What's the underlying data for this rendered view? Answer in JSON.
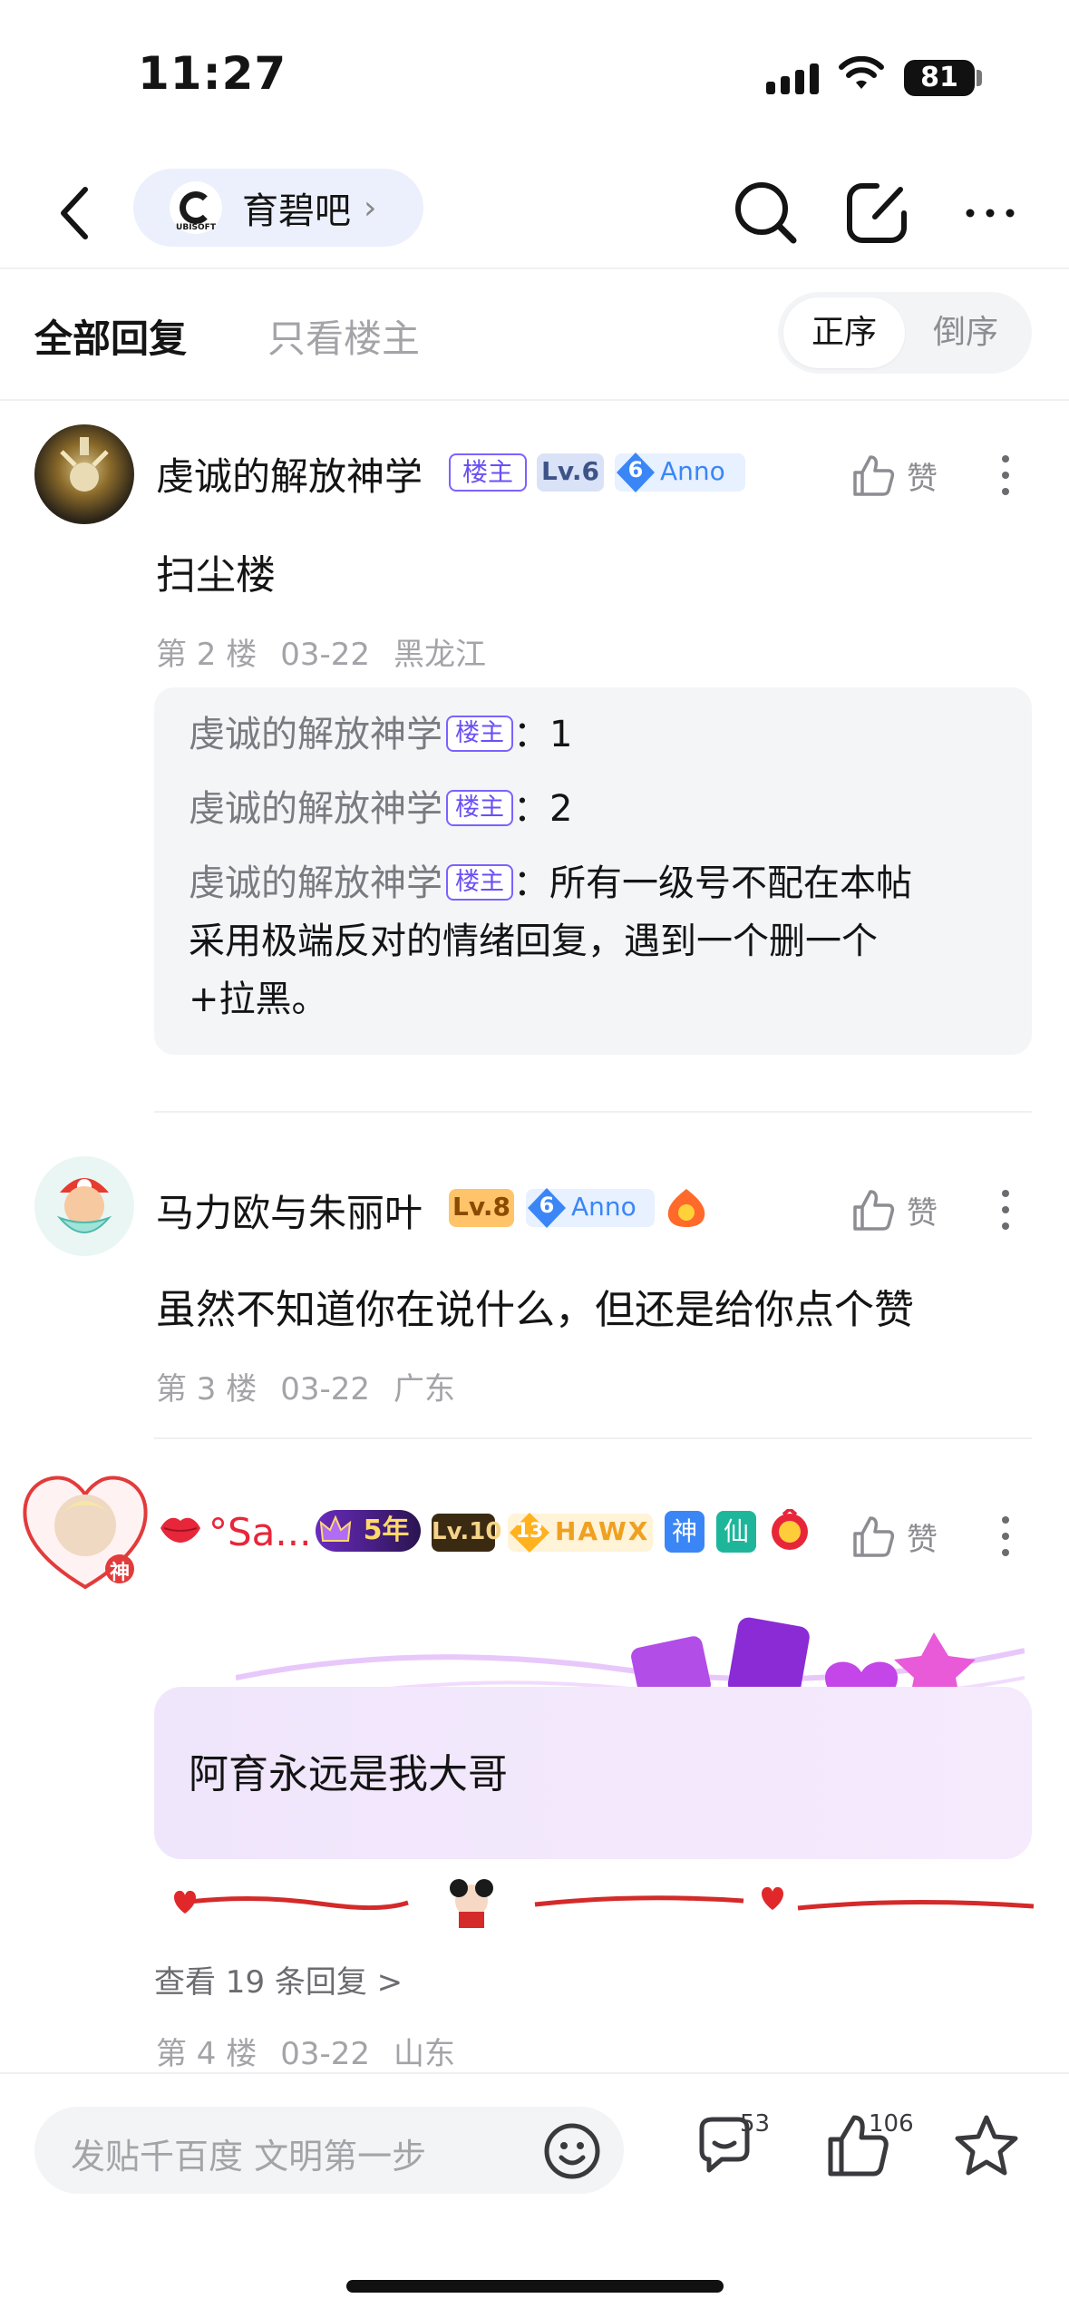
{
  "status_bar": {
    "time": "11:27",
    "battery": "81"
  },
  "nav": {
    "forum_name": "育碧吧",
    "forum_logo_text": "UBISOFT"
  },
  "tabs": {
    "all_replies": "全部回复",
    "only_op": "只看楼主",
    "sort_asc": "正序",
    "sort_desc": "倒序"
  },
  "posts": [
    {
      "username": "虔诚的解放神学",
      "host_badge": "楼主",
      "level": "Lv.6",
      "gem_level": "6",
      "game_badge": "Anno",
      "like_label": "赞",
      "content": "扫尘楼",
      "floor": "第 2 楼",
      "date": "03-22",
      "location": "黑龙江",
      "sub_replies": [
        {
          "name": "虔诚的解放神学",
          "badge": "楼主",
          "text": "1"
        },
        {
          "name": "虔诚的解放神学",
          "badge": "楼主",
          "text": "2"
        },
        {
          "name": "虔诚的解放神学",
          "badge": "楼主",
          "text_line1": "所有一级号不配在本帖",
          "text_line2": "采用极端反对的情绪回复，遇到一个删一个",
          "text_line3": "+拉黑。"
        }
      ]
    },
    {
      "username": "马力欧与朱丽叶",
      "level": "Lv.8",
      "gem_level": "6",
      "game_badge": "Anno",
      "like_label": "赞",
      "content": "虽然不知道你在说什么，但还是给你点个赞",
      "floor": "第 3 楼",
      "date": "03-22",
      "location": "广东"
    },
    {
      "username": "°Sa...",
      "avatar_badge": "神",
      "years_badge": "5年",
      "level": "Lv.10",
      "gem_level": "13",
      "game_badge": "HAWX",
      "title_badge_1": "神",
      "title_badge_2": "仙",
      "like_label": "赞",
      "content": "阿育永远是我大哥",
      "view_replies": "查看 19 条回复 >",
      "floor": "第 4 楼",
      "date": "03-22",
      "location": "山东"
    }
  ],
  "bottom_bar": {
    "input_placeholder": "发贴千百度 文明第一步",
    "comment_count": "53",
    "like_count": "106"
  },
  "colors": {
    "accent_purple": "#6a4ff5",
    "anno_blue": "#3a86f7",
    "lv8_orange": "#ffc46a",
    "lv10_dark": "#3b2a12"
  }
}
